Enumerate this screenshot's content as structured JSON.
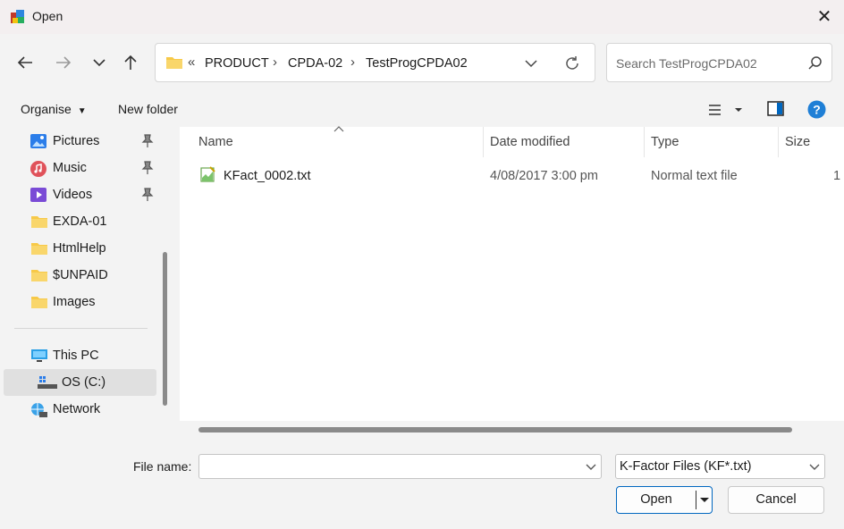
{
  "window": {
    "title": "Open",
    "app_icon": "open-dialog-icon",
    "close_icon": "close-icon"
  },
  "nav": {
    "back_icon": "back-arrow-icon",
    "forward_icon": "forward-arrow-icon",
    "recent_icon": "chevron-down-icon",
    "up_icon": "up-arrow-icon",
    "breadcrumb_overflow": "«",
    "breadcrumb": [
      "PRODUCT",
      "CPDA-02",
      "TestProgCPDA02"
    ],
    "refresh_icon": "refresh-icon",
    "search_placeholder": "Search TestProgCPDA02"
  },
  "toolbar": {
    "organise_label": "Organise",
    "new_folder_label": "New folder",
    "view_icon": "view-list-icon",
    "preview_icon": "preview-pane-icon",
    "help_icon": "help-icon"
  },
  "sidebar": {
    "items": [
      {
        "label": "Pictures",
        "icon": "pictures-icon",
        "pinned": true
      },
      {
        "label": "Music",
        "icon": "music-icon",
        "pinned": true
      },
      {
        "label": "Videos",
        "icon": "videos-icon",
        "pinned": true
      },
      {
        "label": "EXDA-01",
        "icon": "folder-icon",
        "pinned": false
      },
      {
        "label": "HtmlHelp",
        "icon": "folder-icon",
        "pinned": false
      },
      {
        "label": "$UNPAID",
        "icon": "folder-icon",
        "pinned": false
      },
      {
        "label": "Images",
        "icon": "folder-icon",
        "pinned": false
      }
    ],
    "this_pc": "This PC",
    "os_drive": "OS (C:)",
    "network": "Network",
    "selected": "OS (C:)"
  },
  "filelist": {
    "columns": [
      "Name",
      "Date modified",
      "Type",
      "Size"
    ],
    "sort_column": "Name",
    "rows": [
      {
        "name": "KFact_0002.txt",
        "date": "4/08/2017 3:00 pm",
        "type": "Normal text file",
        "size": "1",
        "icon": "text-file-icon"
      }
    ]
  },
  "footer": {
    "file_name_label": "File name:",
    "file_name_value": "",
    "filter_value": "K-Factor Files (KF*.txt)",
    "open_label": "Open",
    "cancel_label": "Cancel"
  },
  "colors": {
    "accent": "#0067c0",
    "folder": "#f7c948",
    "selection": "#e0e0e0"
  }
}
